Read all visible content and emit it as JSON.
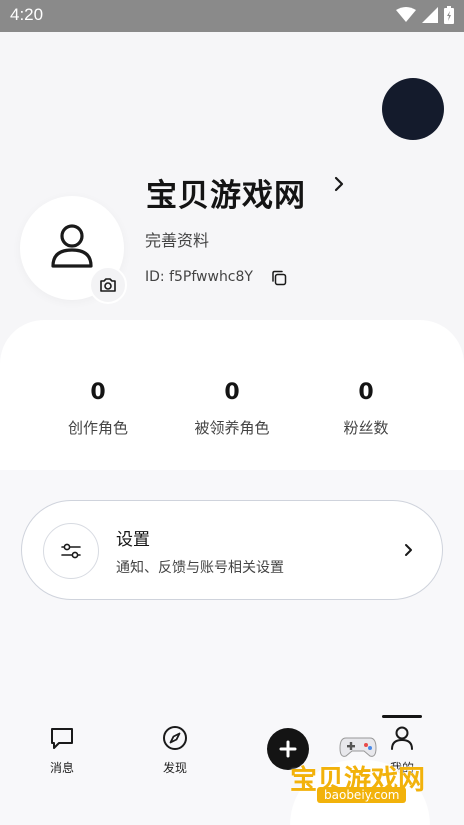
{
  "status_bar": {
    "time": "4:20",
    "icons": [
      "wifi-icon",
      "signal-icon",
      "battery-icon"
    ],
    "color": "#8a8a8a"
  },
  "profile": {
    "name": "宝贝游戏网",
    "complete_profile": "完善资料",
    "id_text": "ID: f5Pfwwhc8Y",
    "avatar_icon": "user-icon",
    "camera_icon": "camera-icon",
    "copy_icon": "copy-icon"
  },
  "stats": [
    {
      "value": "0",
      "label": "创作角色"
    },
    {
      "value": "0",
      "label": "被领养角色"
    },
    {
      "value": "0",
      "label": "粉丝数"
    }
  ],
  "settings": {
    "title": "设置",
    "subtitle": "通知、反馈与账号相关设置",
    "icon": "sliders-icon"
  },
  "bottom_nav": {
    "items": [
      {
        "label": "消息",
        "icon": "message-icon"
      },
      {
        "label": "发现",
        "icon": "compass-icon"
      },
      {
        "label": "",
        "icon": "plus-icon"
      },
      {
        "label": "我的",
        "icon": "user-icon"
      }
    ],
    "active_index": 3
  },
  "watermark": {
    "text": "宝贝游戏网",
    "url": "baobeiy.com"
  },
  "colors": {
    "primary": "#141414",
    "avatar_dark": "#141b2c",
    "watermark": "#f2b20b"
  }
}
